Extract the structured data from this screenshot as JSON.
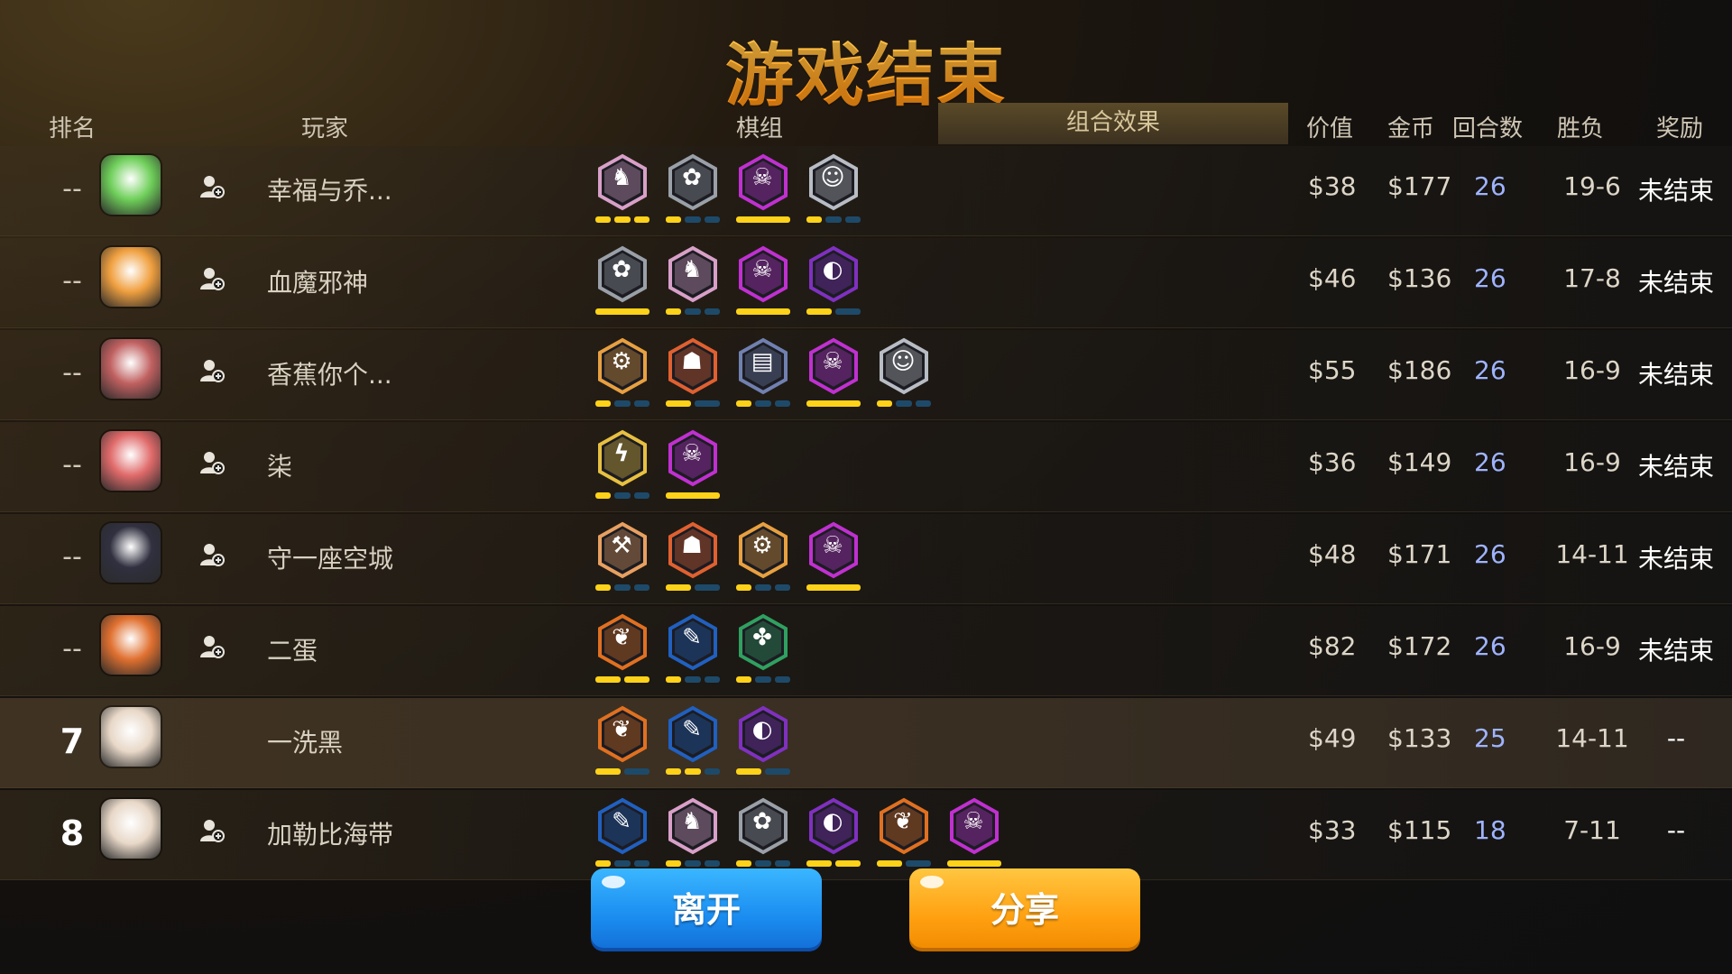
{
  "title": "游戏结束",
  "headers": {
    "rank": "排名",
    "player": "玩家",
    "lineup": "棋组",
    "combo": "组合效果",
    "price": "价值",
    "gold": "金币",
    "rounds": "回合数",
    "winloss": "胜负",
    "reward": "奖励"
  },
  "colors": {
    "accent_gold": "#ffb02a",
    "round_blue": "#9fb4ff",
    "bar_on": "#ffd21a",
    "bar_off": "#1e4a6a",
    "leave_button": "#1a8cf0",
    "share_button": "#ffa010"
  },
  "players": [
    {
      "rank": "--",
      "name": "幸福与乔...",
      "avatar": "green-ogre-avatar",
      "avatar_color": "#6fcf5a",
      "price": "$38",
      "gold": "$177",
      "rounds": "26",
      "winloss": "19-6",
      "reward": "未结束",
      "synergies": [
        {
          "icon": "knight-icon",
          "color": "#d8a0c8",
          "glyph": "♞",
          "bars": 3,
          "filled": 3
        },
        {
          "icon": "beast-paw-icon",
          "color": "#9aa0a8",
          "glyph": "✿",
          "bars": 3,
          "filled": 1
        },
        {
          "icon": "demon-icon",
          "color": "#c030d0",
          "glyph": "☠",
          "bars": 1,
          "filled": 1
        },
        {
          "icon": "human-icon",
          "color": "#b8bcc4",
          "glyph": "☺",
          "bars": 3,
          "filled": 1
        }
      ]
    },
    {
      "rank": "--",
      "name": "血魔邪神",
      "avatar": "blonde-girl-avatar",
      "avatar_color": "#f0a040",
      "price": "$46",
      "gold": "$136",
      "rounds": "26",
      "winloss": "17-8",
      "reward": "未结束",
      "synergies": [
        {
          "icon": "beast-paw-icon",
          "color": "#9aa0a8",
          "glyph": "✿",
          "bars": 1,
          "filled": 1
        },
        {
          "icon": "knight-icon",
          "color": "#d8a0c8",
          "glyph": "♞",
          "bars": 3,
          "filled": 1
        },
        {
          "icon": "demon-icon",
          "color": "#c030d0",
          "glyph": "☠",
          "bars": 1,
          "filled": 1
        },
        {
          "icon": "hooded-icon",
          "color": "#8030c0",
          "glyph": "◐",
          "bars": 2,
          "filled": 1
        }
      ]
    },
    {
      "rank": "--",
      "name": "香蕉你个...",
      "avatar": "backpack-avatar",
      "avatar_color": "#c06060",
      "price": "$55",
      "gold": "$186",
      "rounds": "26",
      "winloss": "16-9",
      "reward": "未结束",
      "synergies": [
        {
          "icon": "gear-icon",
          "color": "#e8a040",
          "glyph": "⚙",
          "bars": 3,
          "filled": 1
        },
        {
          "icon": "ogre-face-icon",
          "color": "#e06030",
          "glyph": "☗",
          "bars": 2,
          "filled": 1
        },
        {
          "icon": "scroll-icon",
          "color": "#7080b0",
          "glyph": "▤",
          "bars": 3,
          "filled": 1
        },
        {
          "icon": "demon-icon",
          "color": "#c030d0",
          "glyph": "☠",
          "bars": 1,
          "filled": 1
        },
        {
          "icon": "human-icon",
          "color": "#b8bcc4",
          "glyph": "☺",
          "bars": 3,
          "filled": 1
        }
      ]
    },
    {
      "rank": "--",
      "name": "柒",
      "avatar": "red-hair-avatar",
      "avatar_color": "#e06a6a",
      "price": "$36",
      "gold": "$149",
      "rounds": "26",
      "winloss": "16-9",
      "reward": "未结束",
      "synergies": [
        {
          "icon": "claws-icon",
          "color": "#e8c040",
          "glyph": "ϟ",
          "bars": 3,
          "filled": 1
        },
        {
          "icon": "demon-icon",
          "color": "#c030d0",
          "glyph": "☠",
          "bars": 1,
          "filled": 1
        }
      ]
    },
    {
      "rank": "--",
      "name": "守一座空城",
      "avatar": "dark-warrior-avatar",
      "avatar_color": "#303040",
      "price": "$48",
      "gold": "$171",
      "rounds": "26",
      "winloss": "14-11",
      "reward": "未结束",
      "synergies": [
        {
          "icon": "axe-icon",
          "color": "#e8a060",
          "glyph": "⚒",
          "bars": 3,
          "filled": 1
        },
        {
          "icon": "ogre-face-icon",
          "color": "#e06030",
          "glyph": "☗",
          "bars": 2,
          "filled": 1
        },
        {
          "icon": "gear-icon",
          "color": "#e8a040",
          "glyph": "⚙",
          "bars": 3,
          "filled": 1
        },
        {
          "icon": "demon-icon",
          "color": "#c030d0",
          "glyph": "☠",
          "bars": 1,
          "filled": 1
        }
      ]
    },
    {
      "rank": "--",
      "name": "二蛋",
      "avatar": "blue-helmet-avatar",
      "avatar_color": "#e07030",
      "price": "$82",
      "gold": "$172",
      "rounds": "26",
      "winloss": "16-9",
      "reward": "未结束",
      "synergies": [
        {
          "icon": "leaf-icon",
          "color": "#e07020",
          "glyph": "❦",
          "bars": 2,
          "filled": 2
        },
        {
          "icon": "feather-icon",
          "color": "#2060c0",
          "glyph": "✎",
          "bars": 3,
          "filled": 1
        },
        {
          "icon": "paw-icon",
          "color": "#30a060",
          "glyph": "✤",
          "bars": 3,
          "filled": 1
        }
      ]
    },
    {
      "rank": "7",
      "name": "一洗黑",
      "avatar": "white-hair-avatar",
      "avatar_color": "#e8d8c8",
      "me": true,
      "price": "$49",
      "gold": "$133",
      "rounds": "25",
      "winloss": "14-11",
      "reward": "--",
      "synergies": [
        {
          "icon": "leaf-icon",
          "color": "#e07020",
          "glyph": "❦",
          "bars": 2,
          "filled": 1
        },
        {
          "icon": "feather-icon",
          "color": "#2060c0",
          "glyph": "✎",
          "bars": 3,
          "filled": 2
        },
        {
          "icon": "hooded-icon",
          "color": "#8030c0",
          "glyph": "◐",
          "bars": 2,
          "filled": 1
        }
      ]
    },
    {
      "rank": "8",
      "name": "加勒比海带",
      "avatar": "white-hair-avatar",
      "avatar_color": "#e8d8c8",
      "price": "$33",
      "gold": "$115",
      "rounds": "18",
      "winloss": "7-11",
      "reward": "--",
      "synergies": [
        {
          "icon": "feather-icon",
          "color": "#2060c0",
          "glyph": "✎",
          "bars": 3,
          "filled": 1
        },
        {
          "icon": "knight-icon",
          "color": "#d8a0c8",
          "glyph": "♞",
          "bars": 3,
          "filled": 1
        },
        {
          "icon": "beast-paw-icon",
          "color": "#9aa0a8",
          "glyph": "✿",
          "bars": 3,
          "filled": 1
        },
        {
          "icon": "hooded-icon",
          "color": "#8030c0",
          "glyph": "◐",
          "bars": 2,
          "filled": 2
        },
        {
          "icon": "leaf-icon",
          "color": "#e07020",
          "glyph": "❦",
          "bars": 2,
          "filled": 1
        },
        {
          "icon": "demon-icon",
          "color": "#c030d0",
          "glyph": "☠",
          "bars": 1,
          "filled": 1
        }
      ]
    }
  ],
  "buttons": {
    "leave": "离开",
    "share": "分享"
  }
}
